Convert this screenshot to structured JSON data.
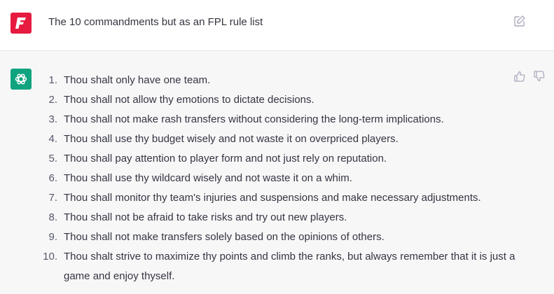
{
  "user_message": {
    "text": "The 10 commandments but as an FPL rule list",
    "avatar_icon": "fpl-f-logo-icon",
    "avatar_color": "#e61b3f",
    "edit_icon": "edit-icon"
  },
  "assistant_message": {
    "avatar_icon": "openai-logo-icon",
    "avatar_color": "#10a37f",
    "feedback_icons": [
      "thumbs-up-icon",
      "thumbs-down-icon"
    ],
    "rules": [
      {
        "num": "1.",
        "text": "Thou shalt only have one team."
      },
      {
        "num": "2.",
        "text": "Thou shall not allow thy emotions to dictate decisions."
      },
      {
        "num": "3.",
        "text": "Thou shall not make rash transfers without considering the long-term implications."
      },
      {
        "num": "4.",
        "text": "Thou shall use thy budget wisely and not waste it on overpriced players."
      },
      {
        "num": "5.",
        "text": "Thou shall pay attention to player form and not just rely on reputation."
      },
      {
        "num": "6.",
        "text": "Thou shall use thy wildcard wisely and not waste it on a whim."
      },
      {
        "num": "7.",
        "text": "Thou shall monitor thy team's injuries and suspensions and make necessary adjustments."
      },
      {
        "num": "8.",
        "text": "Thou shall not be afraid to take risks and try out new players."
      },
      {
        "num": "9.",
        "text": "Thou shall not make transfers solely based on the opinions of others."
      },
      {
        "num": "10.",
        "text": "Thou shalt strive to maximize thy points and climb the ranks, but always remember that it is just a game and enjoy thyself."
      }
    ]
  }
}
